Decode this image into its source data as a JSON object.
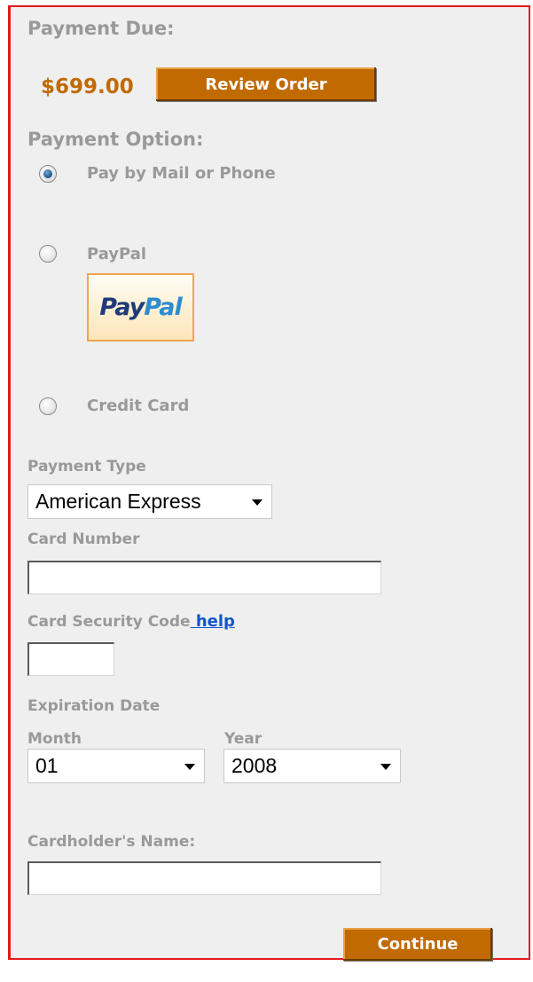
{
  "payment_due": {
    "label": "Payment Due:",
    "amount": "$699.00",
    "review_button": "Review Order"
  },
  "payment_option": {
    "label": "Payment Option:",
    "options": [
      {
        "label": "Pay by Mail or Phone",
        "checked": true
      },
      {
        "label": "PayPal",
        "checked": false
      },
      {
        "label": "Credit Card",
        "checked": false
      }
    ],
    "paypal_logo": {
      "part1": "Pay",
      "part2": "Pal"
    }
  },
  "credit_card": {
    "payment_type_label": "Payment Type",
    "payment_type_value": "American Express",
    "card_number_label": "Card Number",
    "card_number_value": "",
    "security_code_label": "Card Security Code",
    "security_code_help": " help",
    "security_code_value": "",
    "expiration_label": "Expiration Date",
    "month_label": "Month",
    "month_value": "01",
    "year_label": "Year",
    "year_value": "2008",
    "cardholder_label": "Cardholder's Name:",
    "cardholder_value": ""
  },
  "actions": {
    "continue_button": "Continue"
  },
  "colors": {
    "accent": "#c06a00",
    "border": "#e21a1a",
    "muted_text": "#999999",
    "link": "#1155cc",
    "panel_bg": "#efefef"
  }
}
